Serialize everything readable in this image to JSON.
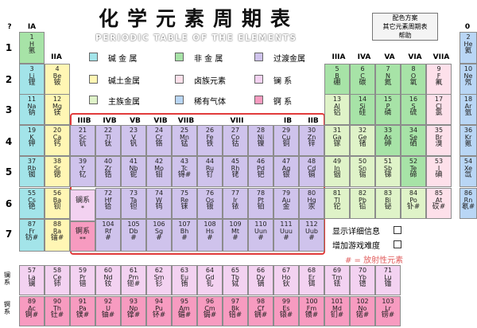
{
  "header": {
    "title": "化学元素周期表",
    "subtitle": "PERIODIC TABLE OF THE ELEMENTS"
  },
  "menu": {
    "items": [
      "配色方案",
      "其它元素周期表",
      "帮助"
    ]
  },
  "legend": [
    {
      "label": "碱 金 属",
      "color": "#a3e4e9"
    },
    {
      "label": "非 金 属",
      "color": "#a7e3a7"
    },
    {
      "label": "过渡金属",
      "color": "#cfc3ec"
    },
    {
      "label": "碱土金属",
      "color": "#fff6b4"
    },
    {
      "label": "卤族元素",
      "color": "#fde0ea"
    },
    {
      "label": "镧    系",
      "color": "#f3d2f1"
    },
    {
      "label": "主族金属",
      "color": "#dff3c8"
    },
    {
      "label": "稀有气体",
      "color": "#b9d6f5"
    },
    {
      "label": "锕    系",
      "color": "#f79bc0"
    }
  ],
  "groups_top": [
    "?",
    "IA",
    "0"
  ],
  "groups_mid": [
    "IIA",
    "IIIA",
    "IVA",
    "VA",
    "VIA",
    "VIIA"
  ],
  "groups_trans": [
    "IIIB",
    "IVB",
    "VB",
    "VIB",
    "VIIB",
    "VIII",
    "IB",
    "IIB"
  ],
  "periods": [
    "1",
    "2",
    "3",
    "4",
    "5",
    "6",
    "7"
  ],
  "options": {
    "detail_label": "显示详细信息",
    "game_label": "增加游戏难度",
    "radioactive_note": "# = 放射性元素"
  },
  "side_labels": {
    "lanthanide": "镧系",
    "actinide": "锕系"
  },
  "lanthanide_placeholder": {
    "cn": "镧系",
    "mark": "*"
  },
  "actinide_placeholder": {
    "cn": "锕系",
    "mark": "**"
  },
  "elements": [
    {
      "n": "1",
      "s": "H",
      "cn": "氢",
      "c": "#a7e3a7"
    },
    {
      "n": "2",
      "s": "He",
      "cn": "氦",
      "c": "#b9d6f5"
    },
    {
      "n": "3",
      "s": "Li",
      "cn": "锂",
      "c": "#a3e4e9"
    },
    {
      "n": "4",
      "s": "Be",
      "cn": "铍",
      "c": "#fff6b4"
    },
    {
      "n": "5",
      "s": "B",
      "cn": "硼",
      "c": "#a7e3a7"
    },
    {
      "n": "6",
      "s": "C",
      "cn": "碳",
      "c": "#a7e3a7"
    },
    {
      "n": "7",
      "s": "N",
      "cn": "氮",
      "c": "#a7e3a7"
    },
    {
      "n": "8",
      "s": "O",
      "cn": "氧",
      "c": "#a7e3a7"
    },
    {
      "n": "9",
      "s": "F",
      "cn": "氟",
      "c": "#fde0ea"
    },
    {
      "n": "10",
      "s": "Ne",
      "cn": "氖",
      "c": "#b9d6f5"
    },
    {
      "n": "11",
      "s": "Na",
      "cn": "钠",
      "c": "#a3e4e9"
    },
    {
      "n": "12",
      "s": "Mg",
      "cn": "镁",
      "c": "#fff6b4"
    },
    {
      "n": "13",
      "s": "Al",
      "cn": "铝",
      "c": "#dff3c8"
    },
    {
      "n": "14",
      "s": "Si",
      "cn": "硅",
      "c": "#a7e3a7"
    },
    {
      "n": "15",
      "s": "P",
      "cn": "磷",
      "c": "#a7e3a7"
    },
    {
      "n": "16",
      "s": "S",
      "cn": "硫",
      "c": "#a7e3a7"
    },
    {
      "n": "17",
      "s": "Cl",
      "cn": "氯",
      "c": "#fde0ea"
    },
    {
      "n": "18",
      "s": "Ar",
      "cn": "氩",
      "c": "#b9d6f5"
    },
    {
      "n": "19",
      "s": "K",
      "cn": "钾",
      "c": "#a3e4e9"
    },
    {
      "n": "20",
      "s": "Ca",
      "cn": "钙",
      "c": "#fff6b4"
    },
    {
      "n": "21",
      "s": "Sc",
      "cn": "钪",
      "c": "#cfc3ec"
    },
    {
      "n": "22",
      "s": "Ti",
      "cn": "钛",
      "c": "#cfc3ec"
    },
    {
      "n": "23",
      "s": "V",
      "cn": "钒",
      "c": "#cfc3ec"
    },
    {
      "n": "24",
      "s": "Cr",
      "cn": "铬",
      "c": "#cfc3ec"
    },
    {
      "n": "25",
      "s": "Mn",
      "cn": "锰",
      "c": "#cfc3ec"
    },
    {
      "n": "26",
      "s": "Fe",
      "cn": "铁",
      "c": "#cfc3ec"
    },
    {
      "n": "27",
      "s": "Co",
      "cn": "钴",
      "c": "#cfc3ec"
    },
    {
      "n": "28",
      "s": "Ni",
      "cn": "镍",
      "c": "#cfc3ec"
    },
    {
      "n": "29",
      "s": "Cu",
      "cn": "铜",
      "c": "#cfc3ec"
    },
    {
      "n": "30",
      "s": "Zn",
      "cn": "锌",
      "c": "#cfc3ec"
    },
    {
      "n": "31",
      "s": "Ga",
      "cn": "镓",
      "c": "#dff3c8"
    },
    {
      "n": "32",
      "s": "Ge",
      "cn": "锗",
      "c": "#dff3c8"
    },
    {
      "n": "33",
      "s": "As",
      "cn": "砷",
      "c": "#a7e3a7"
    },
    {
      "n": "34",
      "s": "Se",
      "cn": "硒",
      "c": "#a7e3a7"
    },
    {
      "n": "35",
      "s": "Br",
      "cn": "溴",
      "c": "#fde0ea"
    },
    {
      "n": "36",
      "s": "Kr",
      "cn": "氪",
      "c": "#b9d6f5"
    },
    {
      "n": "37",
      "s": "Rb",
      "cn": "铷",
      "c": "#a3e4e9"
    },
    {
      "n": "38",
      "s": "Sr",
      "cn": "锶",
      "c": "#fff6b4"
    },
    {
      "n": "39",
      "s": "Y",
      "cn": "钇",
      "c": "#cfc3ec"
    },
    {
      "n": "40",
      "s": "Zr",
      "cn": "锆",
      "c": "#cfc3ec"
    },
    {
      "n": "41",
      "s": "Nb",
      "cn": "铌",
      "c": "#cfc3ec"
    },
    {
      "n": "42",
      "s": "Mo",
      "cn": "钼",
      "c": "#cfc3ec"
    },
    {
      "n": "43",
      "s": "Tc",
      "cn": "锝#",
      "c": "#cfc3ec"
    },
    {
      "n": "44",
      "s": "Ru",
      "cn": "钌",
      "c": "#cfc3ec"
    },
    {
      "n": "45",
      "s": "Rh",
      "cn": "铑",
      "c": "#cfc3ec"
    },
    {
      "n": "46",
      "s": "Pd",
      "cn": "钯",
      "c": "#cfc3ec"
    },
    {
      "n": "47",
      "s": "Ag",
      "cn": "银",
      "c": "#cfc3ec"
    },
    {
      "n": "48",
      "s": "Cd",
      "cn": "镉",
      "c": "#cfc3ec"
    },
    {
      "n": "49",
      "s": "In",
      "cn": "铟",
      "c": "#dff3c8"
    },
    {
      "n": "50",
      "s": "Sn",
      "cn": "锡",
      "c": "#dff3c8"
    },
    {
      "n": "51",
      "s": "Sb",
      "cn": "锑",
      "c": "#dff3c8"
    },
    {
      "n": "52",
      "s": "Te",
      "cn": "碲",
      "c": "#a7e3a7"
    },
    {
      "n": "53",
      "s": "I",
      "cn": "碘",
      "c": "#fde0ea"
    },
    {
      "n": "54",
      "s": "Xe",
      "cn": "氙",
      "c": "#b9d6f5"
    },
    {
      "n": "55",
      "s": "Cs",
      "cn": "铯",
      "c": "#a3e4e9"
    },
    {
      "n": "56",
      "s": "Ba",
      "cn": "钡",
      "c": "#fff6b4"
    },
    {
      "n": "72",
      "s": "Hf",
      "cn": "铪",
      "c": "#cfc3ec"
    },
    {
      "n": "73",
      "s": "Ta",
      "cn": "钽",
      "c": "#cfc3ec"
    },
    {
      "n": "74",
      "s": "W",
      "cn": "钨",
      "c": "#cfc3ec"
    },
    {
      "n": "75",
      "s": "Re",
      "cn": "铼",
      "c": "#cfc3ec"
    },
    {
      "n": "76",
      "s": "Os",
      "cn": "锇",
      "c": "#cfc3ec"
    },
    {
      "n": "77",
      "s": "Ir",
      "cn": "铱",
      "c": "#cfc3ec"
    },
    {
      "n": "78",
      "s": "Pt",
      "cn": "铂",
      "c": "#cfc3ec"
    },
    {
      "n": "79",
      "s": "Au",
      "cn": "金",
      "c": "#cfc3ec"
    },
    {
      "n": "80",
      "s": "Hg",
      "cn": "汞",
      "c": "#cfc3ec"
    },
    {
      "n": "81",
      "s": "Tl",
      "cn": "铊",
      "c": "#dff3c8"
    },
    {
      "n": "82",
      "s": "Pb",
      "cn": "铅",
      "c": "#dff3c8"
    },
    {
      "n": "83",
      "s": "Bi",
      "cn": "铋",
      "c": "#dff3c8"
    },
    {
      "n": "84",
      "s": "Po",
      "cn": "钋#",
      "c": "#dff3c8"
    },
    {
      "n": "85",
      "s": "At",
      "cn": "砹#",
      "c": "#fde0ea"
    },
    {
      "n": "86",
      "s": "Rn",
      "cn": "氡#",
      "c": "#b9d6f5"
    },
    {
      "n": "87",
      "s": "Fr",
      "cn": "钫#",
      "c": "#a3e4e9"
    },
    {
      "n": "88",
      "s": "Ra",
      "cn": "镭#",
      "c": "#fff6b4"
    },
    {
      "n": "104",
      "s": "Rf",
      "cn": "#",
      "c": "#cfc3ec"
    },
    {
      "n": "105",
      "s": "Db",
      "cn": "#",
      "c": "#cfc3ec"
    },
    {
      "n": "106",
      "s": "Sg",
      "cn": "#",
      "c": "#cfc3ec"
    },
    {
      "n": "107",
      "s": "Bh",
      "cn": "#",
      "c": "#cfc3ec"
    },
    {
      "n": "108",
      "s": "Hs",
      "cn": "#",
      "c": "#cfc3ec"
    },
    {
      "n": "109",
      "s": "Mt",
      "cn": "#",
      "c": "#cfc3ec"
    },
    {
      "n": "110",
      "s": "Uun",
      "cn": "#",
      "c": "#cfc3ec"
    },
    {
      "n": "111",
      "s": "Uuu",
      "cn": "#",
      "c": "#cfc3ec"
    },
    {
      "n": "112",
      "s": "Uub",
      "cn": "#",
      "c": "#cfc3ec"
    },
    {
      "n": "57",
      "s": "La",
      "cn": "镧",
      "c": "#f3d2f1"
    },
    {
      "n": "58",
      "s": "Ce",
      "cn": "铈",
      "c": "#f3d2f1"
    },
    {
      "n": "59",
      "s": "Pr",
      "cn": "镨",
      "c": "#f3d2f1"
    },
    {
      "n": "60",
      "s": "Nd",
      "cn": "钕",
      "c": "#f3d2f1"
    },
    {
      "n": "61",
      "s": "Pm",
      "cn": "钷#",
      "c": "#f3d2f1"
    },
    {
      "n": "62",
      "s": "Sm",
      "cn": "钐",
      "c": "#f3d2f1"
    },
    {
      "n": "63",
      "s": "Eu",
      "cn": "铕",
      "c": "#f3d2f1"
    },
    {
      "n": "64",
      "s": "Gd",
      "cn": "钆",
      "c": "#f3d2f1"
    },
    {
      "n": "65",
      "s": "Tb",
      "cn": "铽",
      "c": "#f3d2f1"
    },
    {
      "n": "66",
      "s": "Dy",
      "cn": "镝",
      "c": "#f3d2f1"
    },
    {
      "n": "67",
      "s": "Ho",
      "cn": "钬",
      "c": "#f3d2f1"
    },
    {
      "n": "68",
      "s": "Er",
      "cn": "铒",
      "c": "#f3d2f1"
    },
    {
      "n": "69",
      "s": "Tm",
      "cn": "铥",
      "c": "#f3d2f1"
    },
    {
      "n": "70",
      "s": "Yb",
      "cn": "镱",
      "c": "#f3d2f1"
    },
    {
      "n": "71",
      "s": "Lu",
      "cn": "镥",
      "c": "#f3d2f1"
    },
    {
      "n": "89",
      "s": "Ac",
      "cn": "锕#",
      "c": "#f79bc0"
    },
    {
      "n": "90",
      "s": "Th",
      "cn": "钍#",
      "c": "#f79bc0"
    },
    {
      "n": "91",
      "s": "Pa",
      "cn": "镤#",
      "c": "#f79bc0"
    },
    {
      "n": "92",
      "s": "U",
      "cn": "铀#",
      "c": "#f79bc0"
    },
    {
      "n": "93",
      "s": "Np",
      "cn": "镎#",
      "c": "#f79bc0"
    },
    {
      "n": "94",
      "s": "Pu",
      "cn": "钚#",
      "c": "#f79bc0"
    },
    {
      "n": "95",
      "s": "Am",
      "cn": "镅#",
      "c": "#f79bc0"
    },
    {
      "n": "96",
      "s": "Cm",
      "cn": "锔#",
      "c": "#f79bc0"
    },
    {
      "n": "97",
      "s": "Bk",
      "cn": "锫#",
      "c": "#f79bc0"
    },
    {
      "n": "98",
      "s": "Cf",
      "cn": "锎#",
      "c": "#f79bc0"
    },
    {
      "n": "99",
      "s": "Es",
      "cn": "锿#",
      "c": "#f79bc0"
    },
    {
      "n": "100",
      "s": "Fm",
      "cn": "镄#",
      "c": "#f79bc0"
    },
    {
      "n": "101",
      "s": "Md",
      "cn": "钔#",
      "c": "#f79bc0"
    },
    {
      "n": "102",
      "s": "No",
      "cn": "锘#",
      "c": "#f79bc0"
    },
    {
      "n": "103",
      "s": "Lr",
      "cn": "铹#",
      "c": "#f79bc0"
    }
  ]
}
